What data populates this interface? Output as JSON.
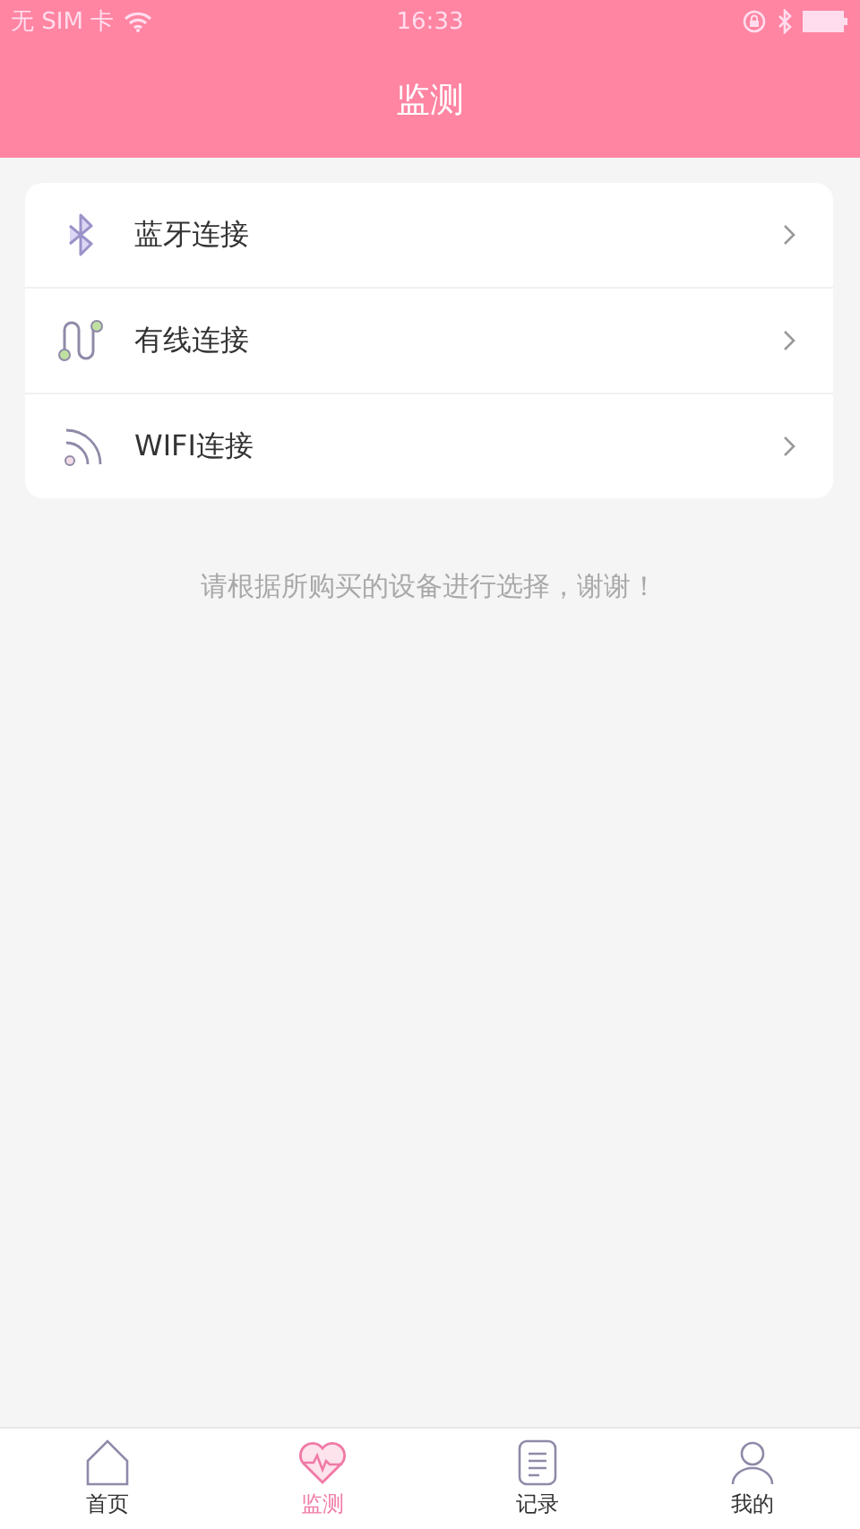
{
  "status_bar": {
    "carrier": "无 SIM 卡",
    "time": "16:33"
  },
  "header": {
    "title": "监测"
  },
  "connections": [
    {
      "kind": "bluetooth",
      "label": "蓝牙连接"
    },
    {
      "kind": "wired",
      "label": "有线连接"
    },
    {
      "kind": "wifi",
      "label": "WIFI连接"
    }
  ],
  "hint": "请根据所购买的设备进行选择，谢谢！",
  "tabs": [
    {
      "kind": "home",
      "label": "首页",
      "selected": false
    },
    {
      "kind": "monitor",
      "label": "监测",
      "selected": true
    },
    {
      "kind": "records",
      "label": "记录",
      "selected": false
    },
    {
      "kind": "profile",
      "label": "我的",
      "selected": false
    }
  ]
}
